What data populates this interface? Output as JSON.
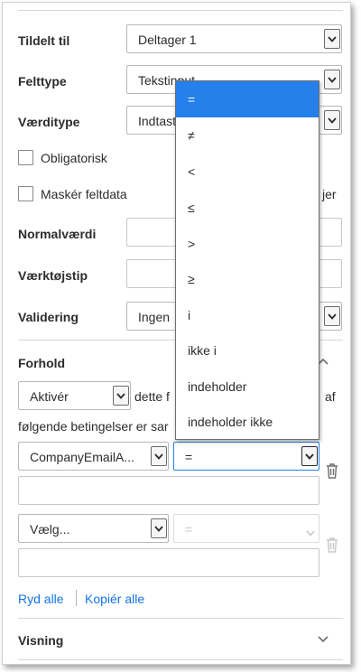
{
  "fields": {
    "tildelt_til": {
      "label": "Tildelt til",
      "value": "Deltager 1"
    },
    "felttype": {
      "label": "Felttype",
      "value": "Tekstinput"
    },
    "vaerditype": {
      "label": "Værditype",
      "value": "Indtastet"
    },
    "obligatorisk": {
      "label": "Obligatorisk",
      "checked": false
    },
    "masker": {
      "label": "Maskér feltdata",
      "checked": false,
      "trailing_text": "jer"
    },
    "normalvaerdi": {
      "label": "Normalværdi",
      "value": ""
    },
    "vaerktojstip": {
      "label": "Værktøjstip",
      "value": ""
    },
    "validering": {
      "label": "Validering",
      "value": "Ingen"
    }
  },
  "forhold": {
    "title": "Forhold",
    "activate": {
      "value": "Aktivér"
    },
    "sentence_part1": "dette f",
    "sentence_part1_end": "af",
    "sentence_part2": "følgende betingelser er sar",
    "condition1": {
      "field": "CompanyEmailA...",
      "operator": "=",
      "value": ""
    },
    "condition2": {
      "field": "Vælg...",
      "operator": "=",
      "value": ""
    },
    "clear_all": "Ryd alle",
    "copy_all": "Kopiér alle"
  },
  "visning": {
    "title": "Visning"
  },
  "operator_dropdown": {
    "options": [
      "=",
      "≠",
      "<",
      "≤",
      ">",
      "≥",
      "i",
      "ikke i",
      "indeholder",
      "indeholder ikke"
    ],
    "selected_index": 0
  },
  "colors": {
    "link": "#1473e6",
    "selected": "#2680eb"
  },
  "icons": {
    "caret": "chevron-down-icon",
    "trash": "trash-icon",
    "collapse": "chevron-up-icon",
    "expand": "chevron-down-icon"
  }
}
